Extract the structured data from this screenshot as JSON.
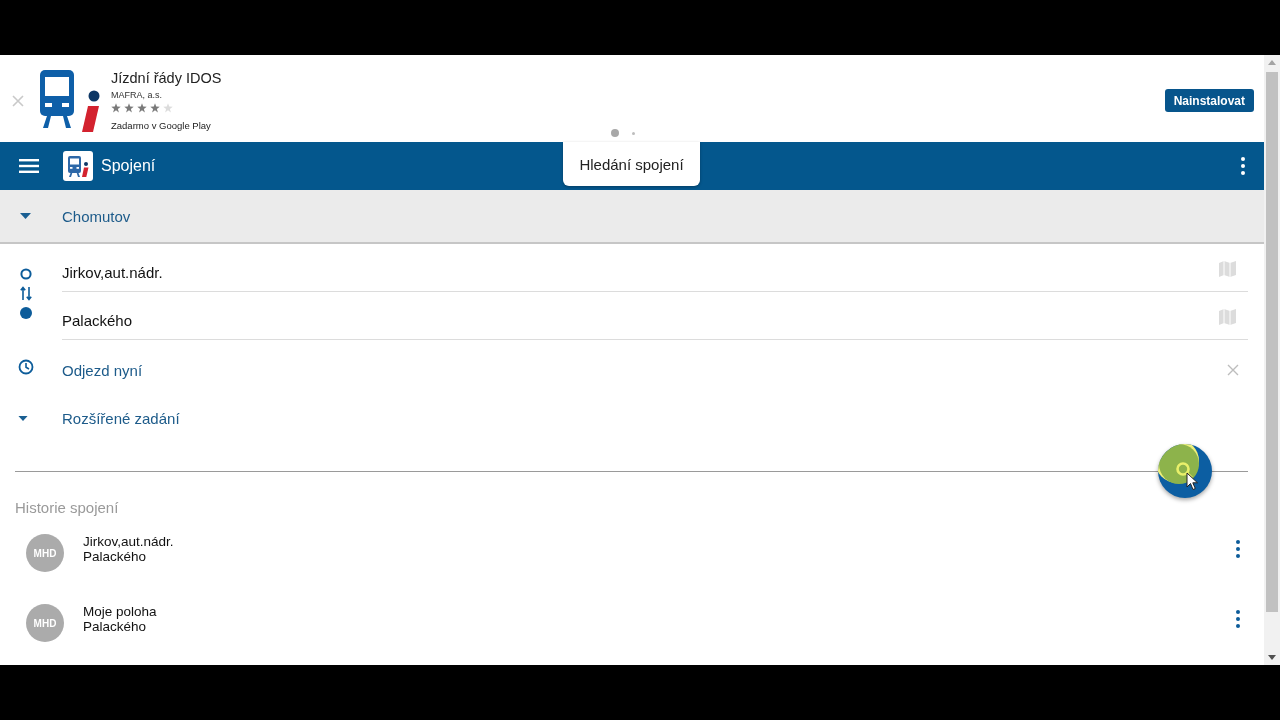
{
  "banner": {
    "app_name": "Jízdní řády IDOS",
    "publisher": "MAFRA, a.s.",
    "stars": 4,
    "store_note": "Zadarmo v Google Play",
    "install_button": "Nainstalovat"
  },
  "toolbar": {
    "title": "Spojení",
    "tooltip": {
      "text": "Hledání spojení",
      "page_dots": [
        {
          "selected": true
        },
        {
          "selected": false
        }
      ]
    }
  },
  "region": {
    "label": "Chomutov"
  },
  "route": {
    "from": "Jirkov,aut.nádr.",
    "to": "Palackého"
  },
  "departure": {
    "label": "Odjezd nyní"
  },
  "advanced": {
    "label": "Rozšířené zadání"
  },
  "history": {
    "title": "Historie spojení",
    "items": [
      {
        "badge": "MHD",
        "from": "Jirkov,aut.nádr.",
        "to": "Palackého"
      },
      {
        "badge": "MHD",
        "from": "Moje poloha",
        "to": "Palackého"
      }
    ]
  }
}
